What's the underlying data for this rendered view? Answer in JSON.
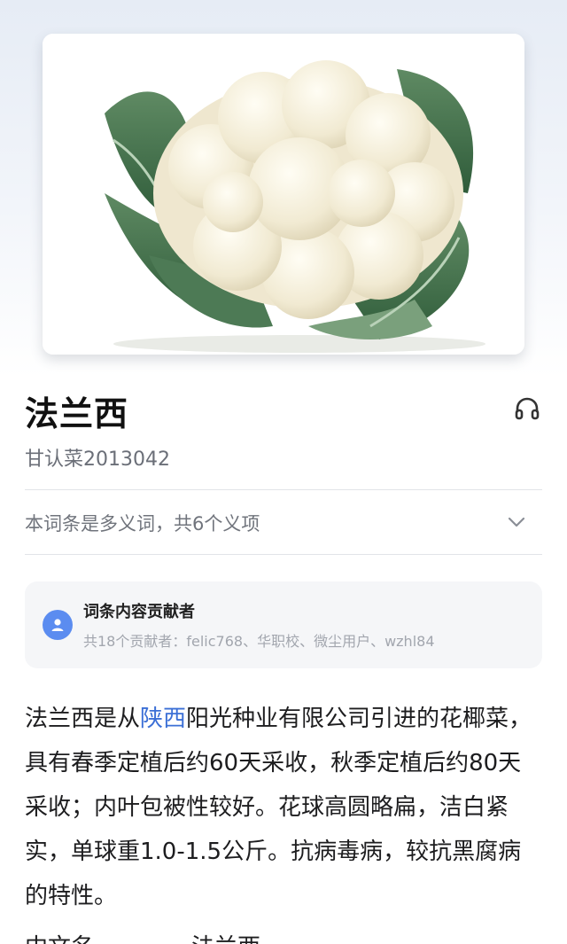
{
  "article": {
    "title": "法兰西",
    "subtitle": "甘认菜2013042",
    "polysemy_text": "本词条是多义词，共6个义项"
  },
  "contributors": {
    "title": "词条内容贡献者",
    "summary": "共18个贡献者：felic768、华职校、微尘用户、wzhl84"
  },
  "description": {
    "part1": "法兰西是从",
    "link": "陕西",
    "part2": "阳光种业有限公司引进的花椰菜，具有春季定植后约60天采收，秋季定植后约80天采收；内叶包被性较好。花球高圆略扁，洁白紧实，单球重1.0-1.5公斤。抗病毒病，较抗黑腐病的特性。"
  },
  "infobox_partial": {
    "label": "中文名",
    "value": "法兰西"
  },
  "icons": {
    "audio": "headphones-icon",
    "expand": "chevron-down-icon",
    "avatar": "user-icon"
  },
  "colors": {
    "link": "#3b6fd6",
    "avatar": "#5b8cf0"
  }
}
